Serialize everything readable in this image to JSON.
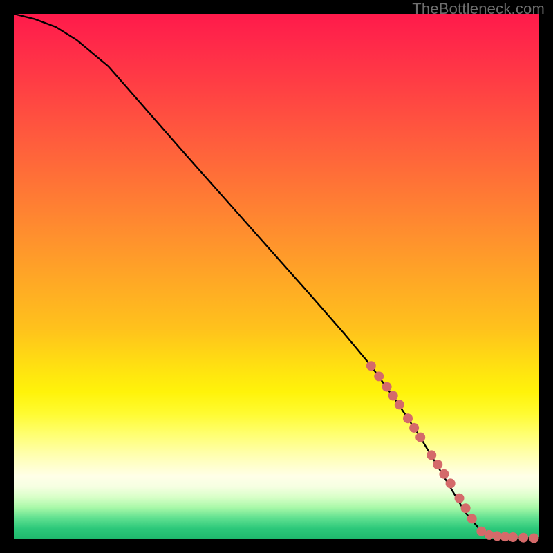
{
  "watermark": "TheBottleneck.com",
  "chart_data": {
    "type": "line",
    "title": "",
    "xlabel": "",
    "ylabel": "",
    "xlim": [
      0,
      100
    ],
    "ylim": [
      0,
      100
    ],
    "grid": false,
    "legend": false,
    "curve": {
      "name": "bottleneck-curve",
      "color": "#000000",
      "x": [
        0,
        4,
        8,
        12,
        18,
        25,
        32,
        40,
        48,
        56,
        63,
        68,
        73,
        77,
        80,
        83,
        86,
        89,
        92,
        95,
        98,
        100
      ],
      "y": [
        100,
        99,
        97.5,
        95,
        90,
        82,
        74,
        65,
        56,
        47,
        39,
        33,
        26,
        20,
        15,
        10,
        5,
        1.5,
        0.6,
        0.3,
        0.2,
        0.2
      ]
    },
    "highlight": {
      "name": "dotted-highlight",
      "color": "#d46a6a",
      "radius_px": 7,
      "points": [
        {
          "x": 68.0,
          "y": 33.0
        },
        {
          "x": 69.5,
          "y": 31.0
        },
        {
          "x": 71.0,
          "y": 29.0
        },
        {
          "x": 72.2,
          "y": 27.3
        },
        {
          "x": 73.4,
          "y": 25.6
        },
        {
          "x": 75.0,
          "y": 23.0
        },
        {
          "x": 76.2,
          "y": 21.2
        },
        {
          "x": 77.4,
          "y": 19.4
        },
        {
          "x": 79.5,
          "y": 16.0
        },
        {
          "x": 80.7,
          "y": 14.2
        },
        {
          "x": 81.9,
          "y": 12.4
        },
        {
          "x": 83.1,
          "y": 10.6
        },
        {
          "x": 84.8,
          "y": 7.8
        },
        {
          "x": 86.0,
          "y": 5.9
        },
        {
          "x": 87.2,
          "y": 3.9
        },
        {
          "x": 89.0,
          "y": 1.5
        },
        {
          "x": 90.5,
          "y": 0.8
        },
        {
          "x": 92.0,
          "y": 0.6
        },
        {
          "x": 93.5,
          "y": 0.5
        },
        {
          "x": 95.0,
          "y": 0.4
        },
        {
          "x": 97.0,
          "y": 0.3
        },
        {
          "x": 99.0,
          "y": 0.2
        }
      ]
    }
  }
}
